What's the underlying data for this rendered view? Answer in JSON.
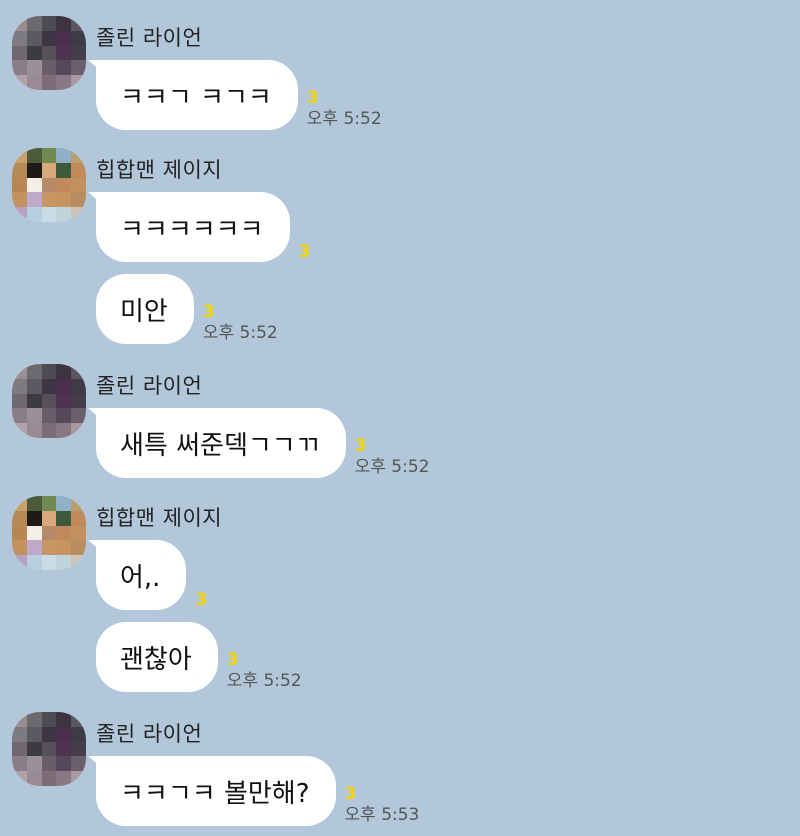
{
  "senders": {
    "a": "졸린 라이언",
    "b": "힙합맨 제이지"
  },
  "groups": [
    {
      "sender": "졸린 라이언",
      "messages": [
        {
          "text": "ㅋㅋㄱ ㅋㄱㅋ",
          "unread": "3",
          "time": "오후 5:52"
        }
      ]
    },
    {
      "sender": "힙합맨 제이지",
      "messages": [
        {
          "text": "ㅋㅋㅋㅋㅋㅋ",
          "unread": "3",
          "time": ""
        },
        {
          "text": "미안",
          "unread": "3",
          "time": "오후 5:52"
        }
      ]
    },
    {
      "sender": "졸린 라이언",
      "messages": [
        {
          "text": "새특 써준덱ㄱㄱㄲ",
          "unread": "3",
          "time": "오후 5:52"
        }
      ]
    },
    {
      "sender": "힙합맨 제이지",
      "messages": [
        {
          "text": "어,.",
          "unread": "3",
          "time": ""
        },
        {
          "text": "괜찮아",
          "unread": "3",
          "time": "오후 5:52"
        }
      ]
    },
    {
      "sender": "졸린 라이언",
      "messages": [
        {
          "text": "ㅋㅋㄱㅋ 볼만해?",
          "unread": "3",
          "time": "오후 5:53"
        }
      ]
    }
  ],
  "colors": {
    "background": "#b2c7d9",
    "bubble": "#ffffff",
    "unread_count": "#f5d400"
  }
}
